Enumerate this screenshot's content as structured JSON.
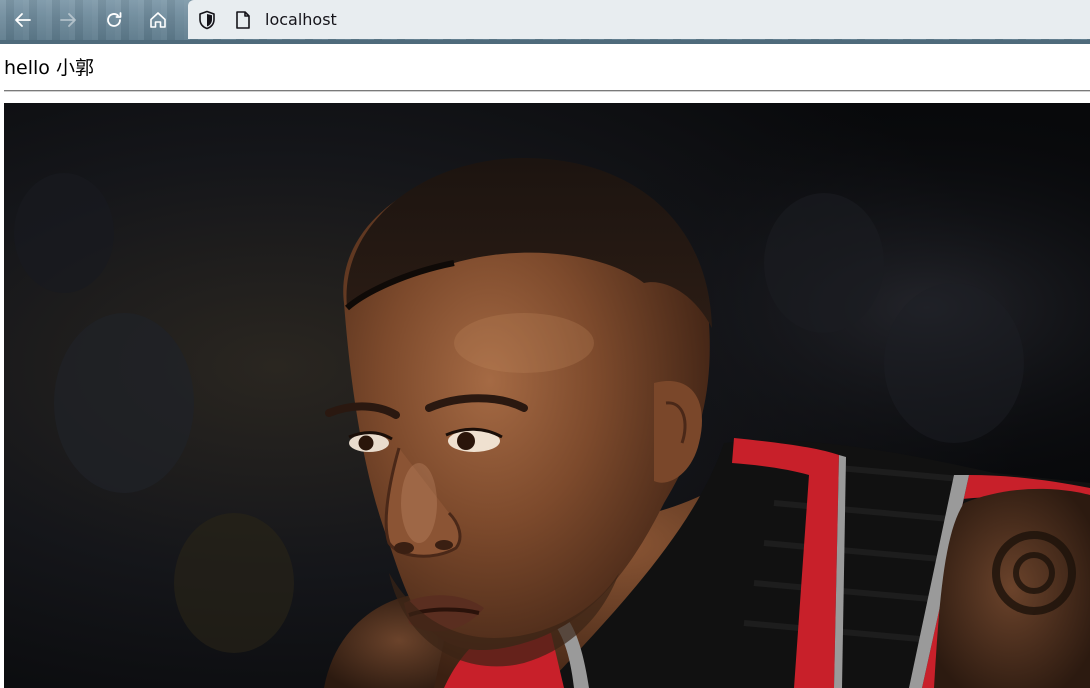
{
  "browser": {
    "url": "localhost",
    "icons": {
      "back": "arrow-left-icon",
      "forward": "arrow-right-icon",
      "reload": "reload-icon",
      "home": "home-icon",
      "tracking": "shield-icon",
      "page": "page-icon"
    }
  },
  "page": {
    "greeting": "hello 小郭",
    "image": {
      "subject": "basketball player close-up photo",
      "colors": {
        "background": "#0b0d10",
        "jersey": "#121212",
        "jersey_trim_red": "#c8202a",
        "jersey_trim_gray": "#9a9a9a",
        "skin": "#7a4a2e"
      }
    }
  }
}
